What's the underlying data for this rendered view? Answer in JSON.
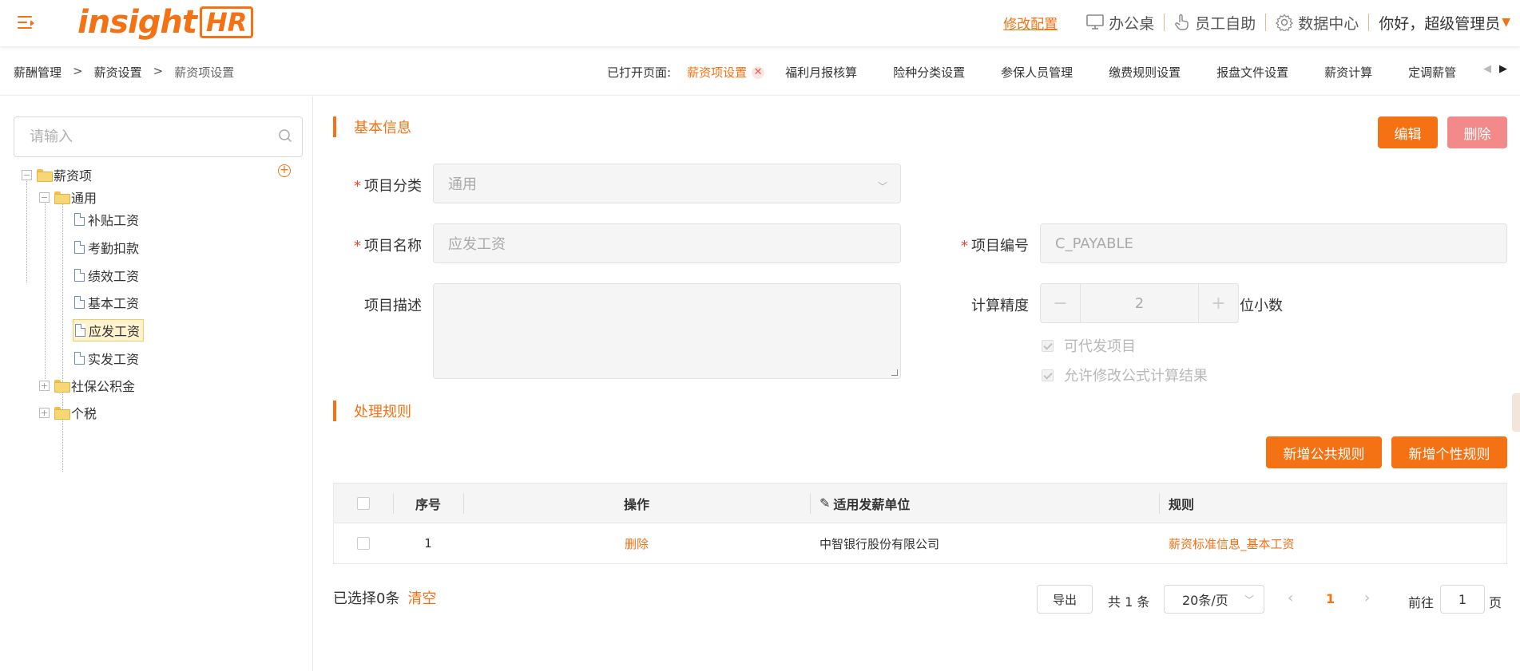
{
  "header": {
    "logo_text_1": "insight",
    "logo_text_2": "HR",
    "config_link": "修改配置",
    "nav": [
      {
        "label": "办公桌",
        "icon": "monitor-icon"
      },
      {
        "label": "员工自助",
        "icon": "hand-pointer-icon"
      },
      {
        "label": "数据中心",
        "icon": "gear-icon"
      }
    ],
    "user_greeting": "你好，超级管理员"
  },
  "breadcrumb": [
    "薪酬管理",
    "薪资设置",
    "薪资项设置"
  ],
  "breadcrumb_sep": ">",
  "open_tabs": {
    "label": "已打开页面:",
    "tabs": [
      "薪资项设置",
      "福利月报核算",
      "险种分类设置",
      "参保人员管理",
      "缴费规则设置",
      "报盘文件设置",
      "薪资计算",
      "定调薪管"
    ]
  },
  "tree": {
    "search_placeholder": "请输入",
    "root": "薪资项",
    "general": "通用",
    "general_items": [
      "补贴工资",
      "考勤扣款",
      "绩效工资",
      "基本工资",
      "应发工资",
      "实发工资"
    ],
    "others": [
      "社保公积金",
      "个税"
    ],
    "selected": "应发工资"
  },
  "basic": {
    "title": "基本信息",
    "edit_btn": "编辑",
    "delete_btn": "删除",
    "category_label": "项目分类",
    "category_value": "通用",
    "name_label": "项目名称",
    "name_value": "应发工资",
    "code_label": "项目编号",
    "code_value": "C_PAYABLE",
    "desc_label": "项目描述",
    "precision_label": "计算精度",
    "precision_value": "2",
    "precision_unit": "位小数",
    "check1": "可代发项目",
    "check2": "允许修改公式计算结果",
    "minus": "−",
    "plus": "+"
  },
  "rules": {
    "title": "处理规则",
    "add_public_btn": "新增公共规则",
    "add_personal_btn": "新增个性规则",
    "columns": {
      "no": "序号",
      "op": "操作",
      "unit": "适用发薪单位",
      "rule": "规则"
    },
    "rows": [
      {
        "no": "1",
        "op": "删除",
        "unit": "中智银行股份有限公司",
        "rule": "薪资标准信息_基本工资"
      }
    ]
  },
  "footer": {
    "selected_text": "已选择0条",
    "clear": "清空",
    "export": "导出",
    "total": "共 1 条",
    "page_size": "20条/页",
    "current_page": "1",
    "goto_label": "前往",
    "goto_value": "1",
    "page_suffix": "页"
  }
}
